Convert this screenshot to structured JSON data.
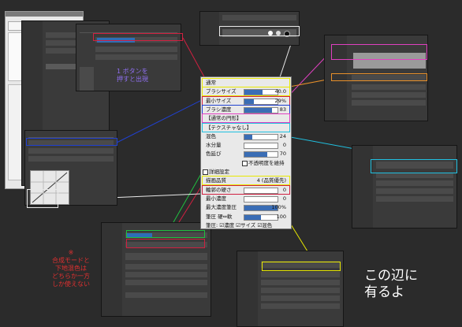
{
  "center_panel": {
    "rows": [
      {
        "label": "通常",
        "value": "",
        "kind": "mode",
        "color": "#e8e800"
      },
      {
        "label": "ブラシサイズ",
        "value": "40.0",
        "kind": "slider",
        "fill": 0.55,
        "color": "#e8e800"
      },
      {
        "label": "最小サイズ",
        "value": "29%",
        "kind": "slider",
        "fill": 0.29,
        "color": "#d02040"
      },
      {
        "label": "ブラシ濃度",
        "value": "83",
        "kind": "slider",
        "fill": 0.83,
        "color": "#2040d0"
      },
      {
        "label": "【通常の円形】",
        "value": "",
        "kind": "select",
        "color": "#e040c0"
      },
      {
        "label": "【テクスチャなし】",
        "value": "",
        "kind": "select",
        "color": "#20c0e0"
      },
      {
        "label": "混色",
        "value": "24",
        "kind": "slider",
        "fill": 0.24,
        "color": ""
      },
      {
        "label": "水分量",
        "value": "0",
        "kind": "slider",
        "fill": 0.0,
        "color": ""
      },
      {
        "label": "色延び",
        "value": "70",
        "kind": "slider",
        "fill": 0.7,
        "color": ""
      },
      {
        "label": "不透明度を維持",
        "value": "",
        "kind": "check",
        "color": ""
      },
      {
        "label": "詳細設定",
        "value": "",
        "kind": "head",
        "color": ""
      },
      {
        "label": "描画品質",
        "value": "4 (品質優先)",
        "kind": "select",
        "color": "#e8e800"
      },
      {
        "label": "輪郭の硬さ",
        "value": "0",
        "kind": "slider",
        "fill": 0.0,
        "color": "#d02040"
      },
      {
        "label": "最小濃度",
        "value": "0",
        "kind": "slider",
        "fill": 0.0,
        "color": ""
      },
      {
        "label": "最大濃度筆圧",
        "value": "100%",
        "kind": "slider",
        "fill": 1.0,
        "color": ""
      },
      {
        "label": "筆圧 硬⇔軟",
        "value": "100",
        "kind": "slider",
        "fill": 0.5,
        "color": ""
      },
      {
        "label": "筆圧: ☑濃度 ☑サイズ ☑混色",
        "value": "",
        "kind": "text",
        "color": ""
      }
    ]
  },
  "captions": {
    "left_note": "1 ボタンを\n押すと出現",
    "bottom_note": "※\n合成モードと\n下地混色は\nどちらか一方\nしか使えない",
    "right_note": "この辺に\n有るよ"
  },
  "colors": {
    "yellow": "#e8e800",
    "red": "#d02040",
    "blue": "#2040d0",
    "magenta": "#e040c0",
    "cyan": "#20c0e0",
    "green": "#20c040",
    "orange": "#e8902a",
    "white": "#ffffff"
  }
}
